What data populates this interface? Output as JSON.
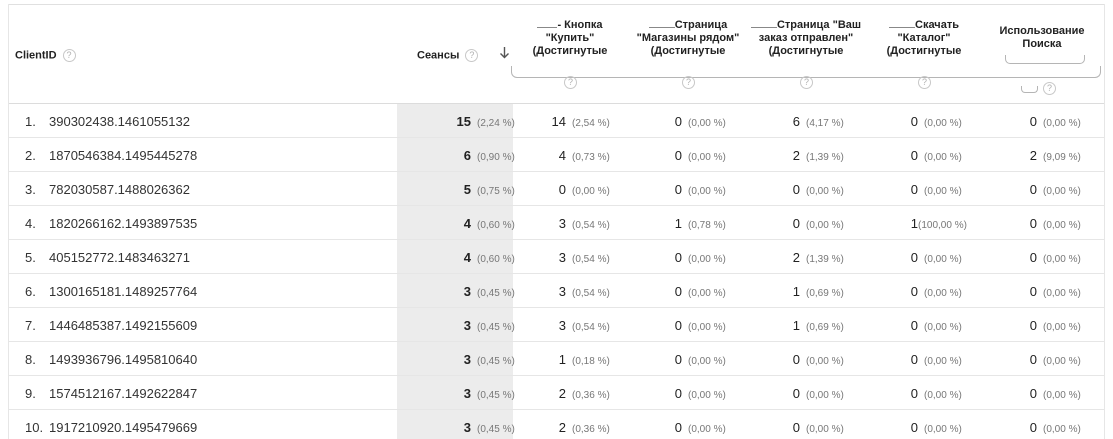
{
  "header": {
    "client_id": "ClientID",
    "sessions": "Сеансы",
    "help_glyph": "?",
    "sort_icon": "arrow-down-icon",
    "goals": [
      {
        "lines": [
          "- Кнопка",
          "\"Купить\"",
          "(Достигнутые"
        ],
        "blank": true
      },
      {
        "lines": [
          "Страница",
          "\"Магазины рядом\"",
          "(Достигнутые"
        ],
        "blank": true
      },
      {
        "lines": [
          "Страница \"Ваш",
          "заказ отправлен\"",
          "(Достигнутые"
        ],
        "blank": true
      },
      {
        "lines": [
          "Скачать",
          "\"Каталог\"",
          "(Достигнутые"
        ],
        "blank": true
      },
      {
        "lines": [
          "Использование",
          "Поиска"
        ],
        "blank": false
      }
    ]
  },
  "rows": [
    {
      "idx": "1.",
      "client": "390302438.1461055132",
      "sessions": {
        "v": "15",
        "p": "(2,24 %)"
      },
      "goals": [
        {
          "v": "14",
          "p": "(2,54 %)"
        },
        {
          "v": "0",
          "p": "(0,00 %)"
        },
        {
          "v": "6",
          "p": "(4,17 %)"
        },
        {
          "v": "0",
          "p": "(0,00 %)"
        },
        {
          "v": "0",
          "p": "(0,00 %)"
        }
      ]
    },
    {
      "idx": "2.",
      "client": "1870546384.1495445278",
      "sessions": {
        "v": "6",
        "p": "(0,90 %)"
      },
      "goals": [
        {
          "v": "4",
          "p": "(0,73 %)"
        },
        {
          "v": "0",
          "p": "(0,00 %)"
        },
        {
          "v": "2",
          "p": "(1,39 %)"
        },
        {
          "v": "0",
          "p": "(0,00 %)"
        },
        {
          "v": "2",
          "p": "(9,09 %)"
        }
      ]
    },
    {
      "idx": "3.",
      "client": "782030587.1488026362",
      "sessions": {
        "v": "5",
        "p": "(0,75 %)"
      },
      "goals": [
        {
          "v": "0",
          "p": "(0,00 %)"
        },
        {
          "v": "0",
          "p": "(0,00 %)"
        },
        {
          "v": "0",
          "p": "(0,00 %)"
        },
        {
          "v": "0",
          "p": "(0,00 %)"
        },
        {
          "v": "0",
          "p": "(0,00 %)"
        }
      ]
    },
    {
      "idx": "4.",
      "client": "1820266162.1493897535",
      "sessions": {
        "v": "4",
        "p": "(0,60 %)"
      },
      "goals": [
        {
          "v": "3",
          "p": "(0,54 %)"
        },
        {
          "v": "1",
          "p": "(0,78 %)"
        },
        {
          "v": "0",
          "p": "(0,00 %)"
        },
        {
          "v": "1",
          "p": "(100,00 %)"
        },
        {
          "v": "0",
          "p": "(0,00 %)"
        }
      ]
    },
    {
      "idx": "5.",
      "client": "405152772.1483463271",
      "sessions": {
        "v": "4",
        "p": "(0,60 %)"
      },
      "goals": [
        {
          "v": "3",
          "p": "(0,54 %)"
        },
        {
          "v": "0",
          "p": "(0,00 %)"
        },
        {
          "v": "2",
          "p": "(1,39 %)"
        },
        {
          "v": "0",
          "p": "(0,00 %)"
        },
        {
          "v": "0",
          "p": "(0,00 %)"
        }
      ]
    },
    {
      "idx": "6.",
      "client": "1300165181.1489257764",
      "sessions": {
        "v": "3",
        "p": "(0,45 %)"
      },
      "goals": [
        {
          "v": "3",
          "p": "(0,54 %)"
        },
        {
          "v": "0",
          "p": "(0,00 %)"
        },
        {
          "v": "1",
          "p": "(0,69 %)"
        },
        {
          "v": "0",
          "p": "(0,00 %)"
        },
        {
          "v": "0",
          "p": "(0,00 %)"
        }
      ]
    },
    {
      "idx": "7.",
      "client": "1446485387.1492155609",
      "sessions": {
        "v": "3",
        "p": "(0,45 %)"
      },
      "goals": [
        {
          "v": "3",
          "p": "(0,54 %)"
        },
        {
          "v": "0",
          "p": "(0,00 %)"
        },
        {
          "v": "1",
          "p": "(0,69 %)"
        },
        {
          "v": "0",
          "p": "(0,00 %)"
        },
        {
          "v": "0",
          "p": "(0,00 %)"
        }
      ]
    },
    {
      "idx": "8.",
      "client": "1493936796.1495810640",
      "sessions": {
        "v": "3",
        "p": "(0,45 %)"
      },
      "goals": [
        {
          "v": "1",
          "p": "(0,18 %)"
        },
        {
          "v": "0",
          "p": "(0,00 %)"
        },
        {
          "v": "0",
          "p": "(0,00 %)"
        },
        {
          "v": "0",
          "p": "(0,00 %)"
        },
        {
          "v": "0",
          "p": "(0,00 %)"
        }
      ]
    },
    {
      "idx": "9.",
      "client": "1574512167.1492622847",
      "sessions": {
        "v": "3",
        "p": "(0,45 %)"
      },
      "goals": [
        {
          "v": "2",
          "p": "(0,36 %)"
        },
        {
          "v": "0",
          "p": "(0,00 %)"
        },
        {
          "v": "0",
          "p": "(0,00 %)"
        },
        {
          "v": "0",
          "p": "(0,00 %)"
        },
        {
          "v": "0",
          "p": "(0,00 %)"
        }
      ]
    },
    {
      "idx": "10.",
      "client": "1917210920.1495479669",
      "sessions": {
        "v": "3",
        "p": "(0,45 %)"
      },
      "goals": [
        {
          "v": "2",
          "p": "(0,36 %)"
        },
        {
          "v": "0",
          "p": "(0,00 %)"
        },
        {
          "v": "0",
          "p": "(0,00 %)"
        },
        {
          "v": "0",
          "p": "(0,00 %)"
        },
        {
          "v": "0",
          "p": "(0,00 %)"
        }
      ]
    }
  ]
}
